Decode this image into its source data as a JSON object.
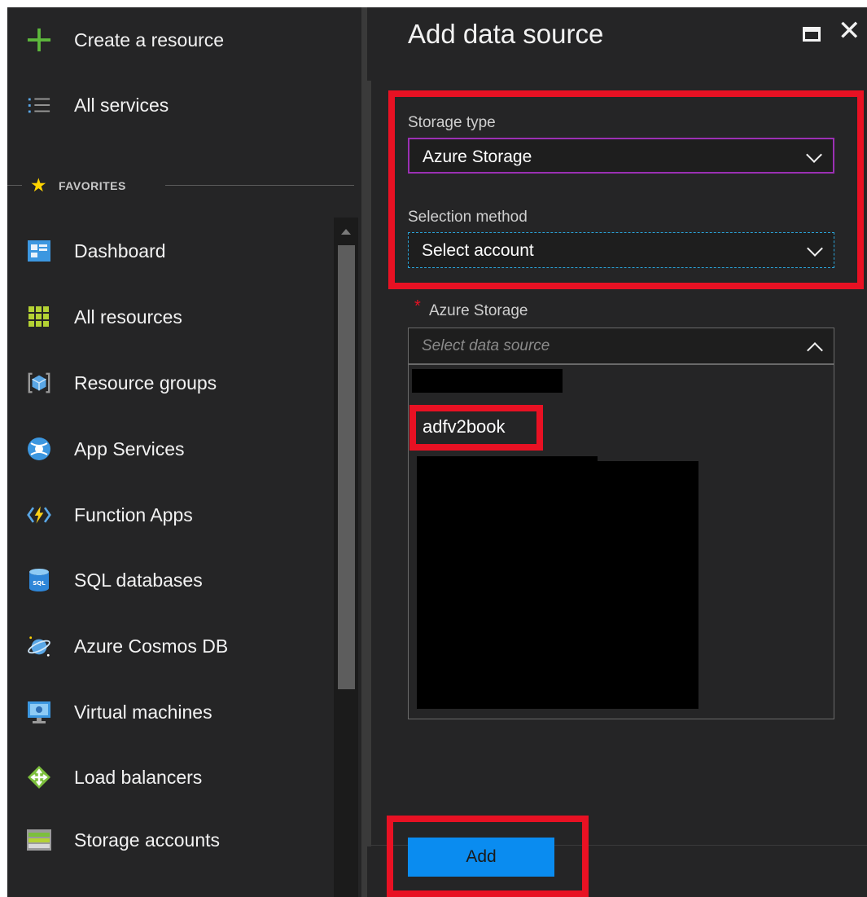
{
  "sidebar": {
    "create_resource": "Create a resource",
    "all_services": "All services",
    "favorites_label": "FAVORITES",
    "items": [
      {
        "label": "Dashboard",
        "icon": "dashboard-icon"
      },
      {
        "label": "All resources",
        "icon": "all-resources-icon"
      },
      {
        "label": "Resource groups",
        "icon": "resource-groups-icon"
      },
      {
        "label": "App Services",
        "icon": "app-services-icon"
      },
      {
        "label": "Function Apps",
        "icon": "function-apps-icon"
      },
      {
        "label": "SQL databases",
        "icon": "sql-databases-icon"
      },
      {
        "label": "Azure Cosmos DB",
        "icon": "cosmos-db-icon"
      },
      {
        "label": "Virtual machines",
        "icon": "virtual-machines-icon"
      },
      {
        "label": "Load balancers",
        "icon": "load-balancers-icon"
      },
      {
        "label": "Storage accounts",
        "icon": "storage-accounts-icon"
      }
    ]
  },
  "blade": {
    "title": "Add data source",
    "storage_type": {
      "label": "Storage type",
      "value": "Azure Storage"
    },
    "selection_method": {
      "label": "Selection method",
      "value": "Select account"
    },
    "data_source": {
      "label": "Azure Storage",
      "required_mark": "*",
      "placeholder": "Select data source",
      "options": [
        "adfv2book"
      ]
    },
    "add_button": "Add"
  },
  "colors": {
    "accent": "#0a8cf0",
    "highlight": "#e81123",
    "background": "#252526",
    "focus_outline": "#9b30b4",
    "dashed_outline": "#2aa3d8"
  }
}
